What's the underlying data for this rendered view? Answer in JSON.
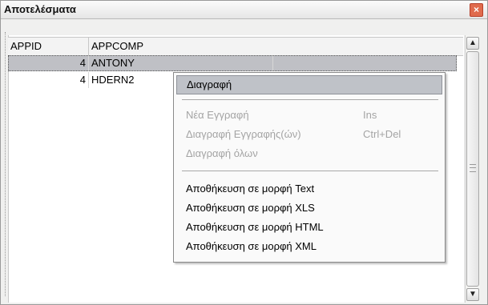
{
  "window": {
    "title": "Αποτελέσματα",
    "close_glyph": "×"
  },
  "grid": {
    "columns": [
      "APPID",
      "APPCOMP"
    ],
    "rows": [
      {
        "id": "4",
        "comp": "ANTONY"
      },
      {
        "id": "4",
        "comp": "HDERN2"
      }
    ]
  },
  "scrollbar": {
    "up_glyph": "▲",
    "down_glyph": "▼"
  },
  "context_menu": {
    "delete": "Διαγραφή",
    "new_record": "Νέα Εγγραφή",
    "new_record_shortcut": "Ins",
    "delete_records": "Διαγραφή Εγγραφής(ών)",
    "delete_records_shortcut": "Ctrl+Del",
    "delete_all": "Διαγραφή όλων",
    "save_text": "Αποθήκευση σε μορφή Text",
    "save_xls": "Αποθήκευση σε μορφή XLS",
    "save_html": "Αποθήκευση σε μορφή HTML",
    "save_xml": "Αποθήκευση σε μορφή XML"
  },
  "icons": {
    "close": "close-icon",
    "scroll_up": "arrow-up-icon",
    "scroll_down": "arrow-down-icon"
  },
  "colors": {
    "selection": "#bfc0c5",
    "menu_highlight": "#bfc2c8",
    "close_button": "#e06b4d",
    "disabled_text": "#a4a4a4"
  }
}
